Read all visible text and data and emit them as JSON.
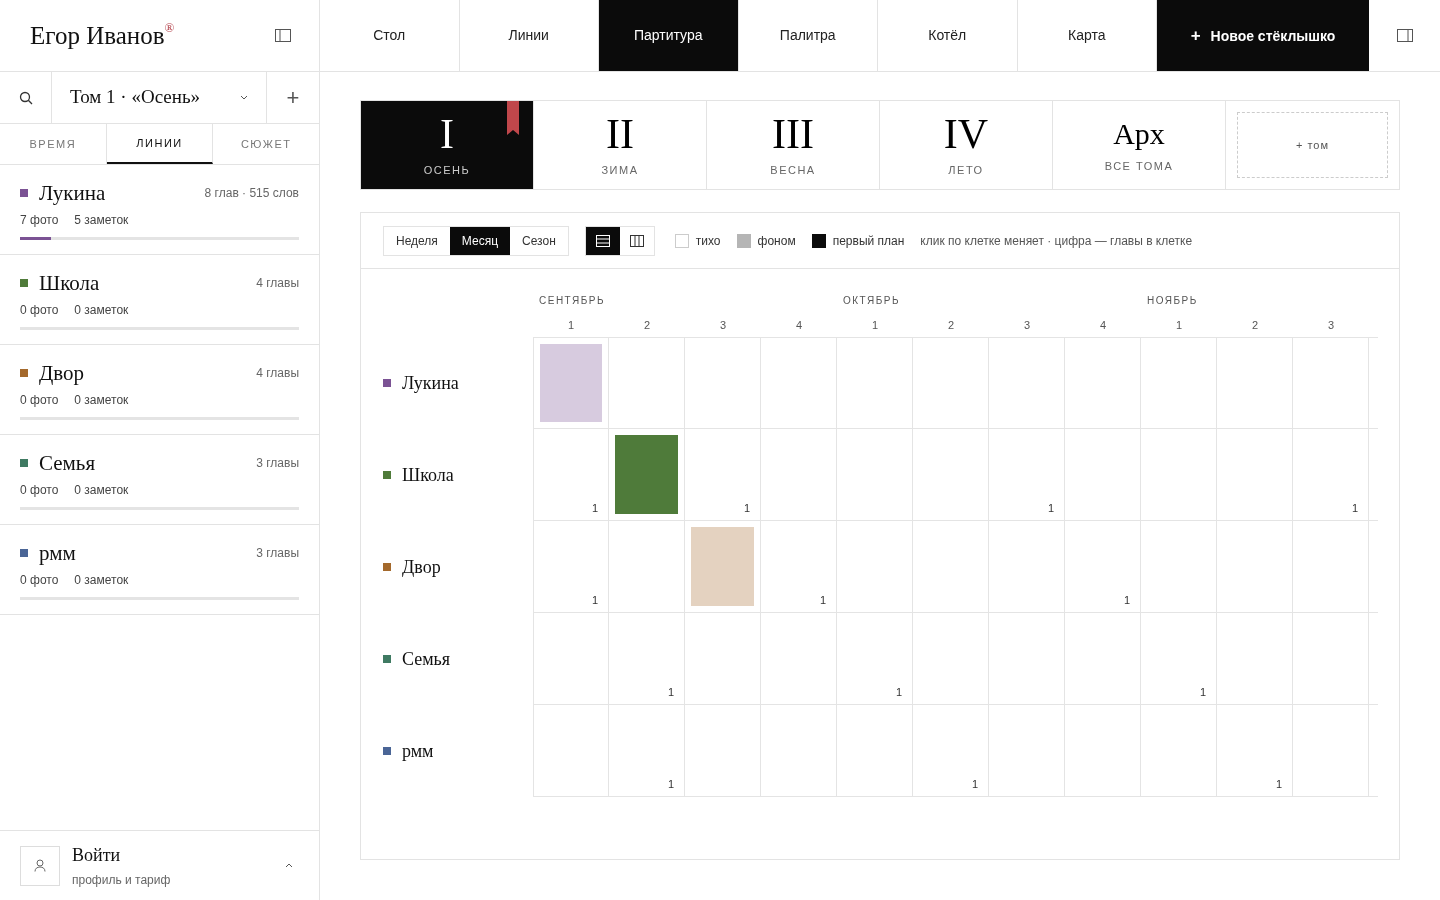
{
  "brand": {
    "name": "Егор Иванов",
    "mark": "®"
  },
  "nav": [
    {
      "label": "Стол",
      "selected": false
    },
    {
      "label": "Линии",
      "selected": false
    },
    {
      "label": "Партитура",
      "selected": true
    },
    {
      "label": "Палитра",
      "selected": false
    },
    {
      "label": "Котёл",
      "selected": false
    },
    {
      "label": "Карта",
      "selected": false
    }
  ],
  "new_button": {
    "icon": "+",
    "label": "Новое стёклышко"
  },
  "volume_select": {
    "value": "Том 1 · «Осень»",
    "plus": "+"
  },
  "sidebar_tabs": [
    {
      "label": "ВРЕМЯ",
      "selected": false
    },
    {
      "label": "ЛИНИИ",
      "selected": true
    },
    {
      "label": "СЮЖЕТ",
      "selected": false
    }
  ],
  "lines": [
    {
      "name": "Лукина",
      "color": "#7b5294",
      "meta": "8 глав · 515 слов",
      "photos": "7 фото",
      "notes": "5 заметок",
      "level": 0.11
    },
    {
      "name": "Школа",
      "color": "#4f7b3a",
      "meta": "4 главы",
      "photos": "0 фото",
      "notes": "0 заметок",
      "level": 0
    },
    {
      "name": "Двор",
      "color": "#a4692c",
      "meta": "4 главы",
      "photos": "0 фото",
      "notes": "0 заметок",
      "level": 0
    },
    {
      "name": "Семья",
      "color": "#3f7a62",
      "meta": "3 главы",
      "photos": "0 фото",
      "notes": "0 заметок",
      "level": 0
    },
    {
      "name": "рмм",
      "color": "#4a6596",
      "meta": "3 главы",
      "photos": "0 фото",
      "notes": "0 заметок",
      "level": 0
    }
  ],
  "account": {
    "title": "Войти",
    "subtitle": "профиль и тариф"
  },
  "volumes": [
    {
      "kind": "numeral",
      "numeral": "I",
      "label": "ОСЕНЬ",
      "selected": true,
      "bookmark": true
    },
    {
      "kind": "numeral",
      "numeral": "II",
      "label": "ЗИМА",
      "selected": false,
      "bookmark": false
    },
    {
      "kind": "numeral",
      "numeral": "III",
      "label": "ВЕСНА",
      "selected": false,
      "bookmark": false
    },
    {
      "kind": "numeral",
      "numeral": "IV",
      "label": "ЛЕТО",
      "selected": false,
      "bookmark": false
    },
    {
      "kind": "archive",
      "numeral": "Арх",
      "label": "ВСЕ ТОМА",
      "selected": false,
      "bookmark": false
    }
  ],
  "add_volume": "+ том",
  "scale": [
    {
      "label": "Неделя",
      "selected": false
    },
    {
      "label": "Месяц",
      "selected": true
    },
    {
      "label": "Сезон",
      "selected": false
    }
  ],
  "layouts": [
    {
      "kind": "rows",
      "selected": true
    },
    {
      "kind": "columns",
      "selected": false
    }
  ],
  "legend": [
    {
      "kind": "quiet",
      "label": "тихо"
    },
    {
      "kind": "background",
      "label": "фоном"
    },
    {
      "kind": "foreground",
      "label": "первый план"
    }
  ],
  "hint": "клик по клетке меняет · цифра — главы в клетке",
  "months": [
    {
      "label": "СЕНТЯБРЬ",
      "weeks": [
        "1",
        "2",
        "3",
        "4"
      ]
    },
    {
      "label": "ОКТЯБРЬ",
      "weeks": [
        "1",
        "2",
        "3",
        "4"
      ]
    },
    {
      "label": "НОЯБРЬ",
      "weeks": [
        "1",
        "2",
        "3"
      ]
    }
  ],
  "rows": [
    {
      "line": "Лукина",
      "color": "#7b5294",
      "cells": [
        {
          "kind": "background"
        },
        {
          "kind": "quiet"
        },
        {
          "kind": "quiet"
        },
        {
          "kind": "quiet"
        },
        {
          "kind": "quiet"
        },
        {
          "kind": "quiet"
        },
        {
          "kind": "quiet"
        },
        {
          "kind": "quiet"
        },
        {
          "kind": "quiet"
        },
        {
          "kind": "quiet"
        },
        {
          "kind": "quiet"
        }
      ]
    },
    {
      "line": "Школа",
      "color": "#4f7b3a",
      "cells": [
        {
          "kind": "quiet",
          "count": "1"
        },
        {
          "kind": "foreground"
        },
        {
          "kind": "quiet",
          "count": "1"
        },
        {
          "kind": "quiet"
        },
        {
          "kind": "quiet"
        },
        {
          "kind": "quiet"
        },
        {
          "kind": "quiet",
          "count": "1"
        },
        {
          "kind": "quiet"
        },
        {
          "kind": "quiet"
        },
        {
          "kind": "quiet"
        },
        {
          "kind": "quiet",
          "count": "1"
        }
      ]
    },
    {
      "line": "Двор",
      "color": "#a4692c",
      "cells": [
        {
          "kind": "quiet",
          "count": "1"
        },
        {
          "kind": "quiet"
        },
        {
          "kind": "background"
        },
        {
          "kind": "quiet",
          "count": "1"
        },
        {
          "kind": "quiet"
        },
        {
          "kind": "quiet"
        },
        {
          "kind": "quiet"
        },
        {
          "kind": "quiet",
          "count": "1"
        },
        {
          "kind": "quiet"
        },
        {
          "kind": "quiet"
        },
        {
          "kind": "quiet"
        }
      ]
    },
    {
      "line": "Семья",
      "color": "#3f7a62",
      "cells": [
        {
          "kind": "quiet"
        },
        {
          "kind": "quiet",
          "count": "1"
        },
        {
          "kind": "quiet"
        },
        {
          "kind": "quiet"
        },
        {
          "kind": "quiet",
          "count": "1"
        },
        {
          "kind": "quiet"
        },
        {
          "kind": "quiet"
        },
        {
          "kind": "quiet"
        },
        {
          "kind": "quiet",
          "count": "1"
        },
        {
          "kind": "quiet"
        },
        {
          "kind": "quiet"
        }
      ]
    },
    {
      "line": "рмм",
      "color": "#4a6596",
      "cells": [
        {
          "kind": "quiet"
        },
        {
          "kind": "quiet",
          "count": "1"
        },
        {
          "kind": "quiet"
        },
        {
          "kind": "quiet"
        },
        {
          "kind": "quiet"
        },
        {
          "kind": "quiet",
          "count": "1"
        },
        {
          "kind": "quiet"
        },
        {
          "kind": "quiet"
        },
        {
          "kind": "quiet"
        },
        {
          "kind": "quiet",
          "count": "1"
        },
        {
          "kind": "quiet"
        }
      ]
    }
  ]
}
